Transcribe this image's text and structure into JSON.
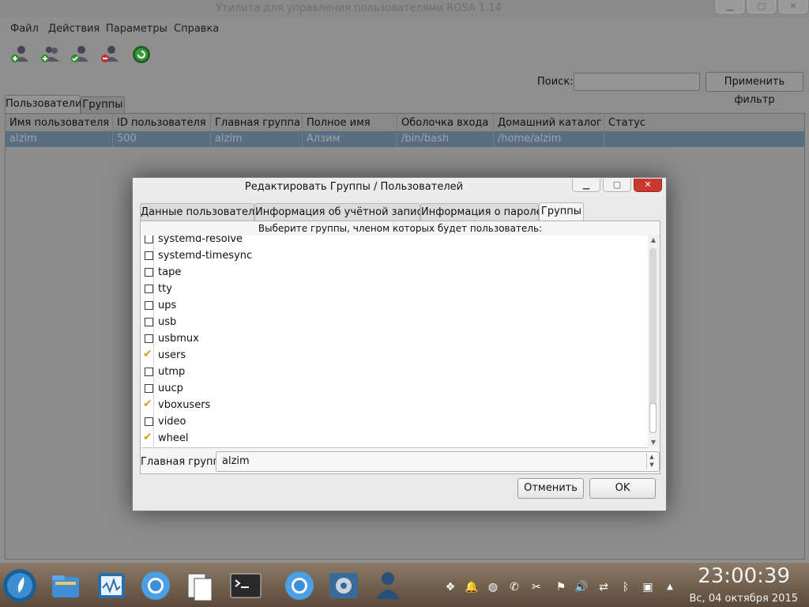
{
  "window": {
    "title": "Утилита для управления пользователями ROSA 1.14"
  },
  "menu": [
    "Файл",
    "Действия",
    "Параметры",
    "Справка"
  ],
  "toolbar": [
    "add-user-icon",
    "add-group-icon",
    "properties-icon",
    "delete-icon",
    "refresh-icon"
  ],
  "search": {
    "label": "Поиск:",
    "value": "",
    "button": "Применить фильтр"
  },
  "main_tabs": [
    "Пользователи",
    "Группы"
  ],
  "table": {
    "columns": [
      "Имя пользователя",
      "ID пользователя",
      "Главная группа",
      "Полное имя",
      "Оболочка входа",
      "Домашний каталог",
      "Статус"
    ],
    "rows": [
      [
        "alzim",
        "500",
        "alzim",
        "Алзим",
        "/bin/bash",
        "/home/alzim",
        ""
      ]
    ]
  },
  "dialog": {
    "title": "Редактировать Группы / Пользователей",
    "tabs": [
      "Данные пользователя",
      "Информация об учётной записи",
      "Информация о пароле",
      "Группы"
    ],
    "active_tab": "Группы",
    "prompt": "Выберите группы, членом которых будет пользователь:",
    "groups": [
      {
        "name": "systemd-resolve",
        "checked": false
      },
      {
        "name": "systemd-timesync",
        "checked": false
      },
      {
        "name": "tape",
        "checked": false
      },
      {
        "name": "tty",
        "checked": false
      },
      {
        "name": "ups",
        "checked": false
      },
      {
        "name": "usb",
        "checked": false
      },
      {
        "name": "usbmux",
        "checked": false
      },
      {
        "name": "users",
        "checked": true
      },
      {
        "name": "utmp",
        "checked": false
      },
      {
        "name": "uucp",
        "checked": false
      },
      {
        "name": "vboxusers",
        "checked": true
      },
      {
        "name": "video",
        "checked": false
      },
      {
        "name": "wheel",
        "checked": true
      }
    ],
    "primary_group_label": "Главная группа",
    "primary_group_value": "alzim",
    "cancel": "Отменить",
    "ok": "OK"
  },
  "taskbar": {
    "time": "23:00:39",
    "date": "Вс, 04 октября 2015"
  },
  "colors": {
    "selection": "#5a6e82",
    "check": "#d1a21c",
    "close_button": "#c9382c"
  }
}
